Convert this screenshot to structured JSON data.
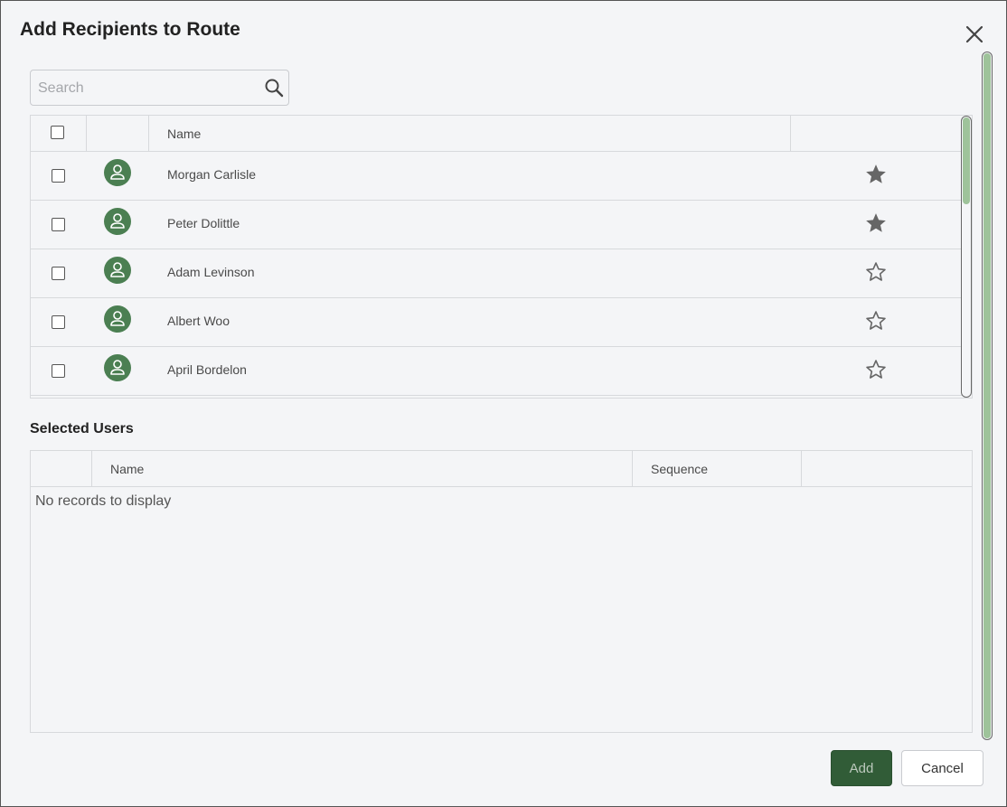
{
  "dialog": {
    "title": "Add Recipients to Route",
    "close_icon": "close-icon"
  },
  "search": {
    "placeholder": "Search",
    "value": "",
    "icon": "search-icon"
  },
  "users_grid": {
    "columns": [
      "",
      "",
      "Name",
      ""
    ],
    "rows": [
      {
        "name": "Morgan Carlisle",
        "favorite": true
      },
      {
        "name": "Peter Dolittle",
        "favorite": true
      },
      {
        "name": "Adam Levinson",
        "favorite": false
      },
      {
        "name": "Albert Woo",
        "favorite": false
      },
      {
        "name": "April Bordelon",
        "favorite": false
      }
    ]
  },
  "selected": {
    "title": "Selected Users",
    "columns": [
      "",
      "Name",
      "Sequence",
      ""
    ],
    "empty_text": "No records to display"
  },
  "footer": {
    "add_label": "Add",
    "cancel_label": "Cancel"
  },
  "colors": {
    "accent_green": "#315c37",
    "avatar_green": "#4b7f52",
    "scroll_green": "#9ec39a",
    "star": "#666666"
  }
}
